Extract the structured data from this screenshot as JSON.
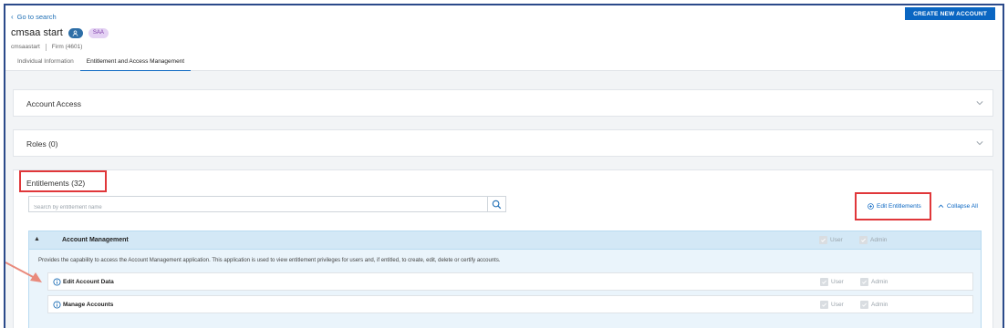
{
  "nav": {
    "back_label": "Go to search",
    "create_button": "CREATE NEW ACCOUNT"
  },
  "account": {
    "name": "cmsaa start",
    "badge": "SAA",
    "username": "cmsaastart",
    "firm": "Firm (4601)"
  },
  "tabs": [
    {
      "label": "Individual Information",
      "active": false
    },
    {
      "label": "Entitlement and Access Management",
      "active": true
    }
  ],
  "sections": {
    "account_access": "Account Access",
    "roles": "Roles (0)",
    "entitlements": "Entitlements (32)"
  },
  "entitlements": {
    "search_placeholder": "Search by entitlement name",
    "edit_label": "Edit Entitlements",
    "collapse_label": "Collapse All",
    "group": {
      "title": "Account Management",
      "description": "Provides the capability to access the Account Management application. This application is used to view entitlement privileges for users and, if entitled, to create, edit, delete or certify accounts.",
      "user_label": "User",
      "admin_label": "Admin",
      "items": [
        {
          "title": "Edit Account Data",
          "user_label": "User",
          "admin_label": "Admin"
        },
        {
          "title": "Manage Accounts",
          "user_label": "User",
          "admin_label": "Admin"
        }
      ]
    }
  },
  "colors": {
    "accent": "#0a66c2",
    "highlight": "#e0373a",
    "badge_bg": "#e4d2f4",
    "group_bg": "#d3e8f6"
  }
}
